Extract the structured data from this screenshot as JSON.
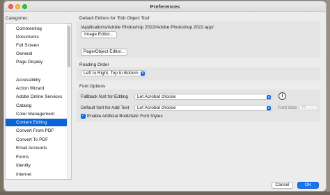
{
  "window": {
    "title": "Preferences"
  },
  "categories": {
    "label": "Categories:",
    "items": [
      "Commenting",
      "Documents",
      "Full Screen",
      "General",
      "Page Display",
      "Accessibility",
      "Action Wizard",
      "Adobe Online Services",
      "Catalog",
      "Color Management",
      "Content Editing",
      "Convert From PDF",
      "Convert To PDF",
      "Email Accounts",
      "Forms",
      "Identity",
      "Internet"
    ],
    "selected": "Content Editing"
  },
  "default_editors": {
    "title": "Default Editors for 'Edit Object Tool'",
    "image_path": "/Applications/Adobe Photoshop 2022/Adobe Photoshop 2022.app/",
    "image_editor_button": "Image Editor...",
    "page_object_editor_button": "Page/Object Editor..."
  },
  "reading_order": {
    "title": "Reading Order",
    "value": "Left to Right, Top to Bottom"
  },
  "font_options": {
    "title": "Font Options",
    "fallback_label": "Fallback font for Editing",
    "fallback_value": "Let Acrobat choose",
    "default_label": "Default font for Add Text",
    "default_value": "Let Acrobat choose",
    "font_size_label": "Font Size",
    "font_size_value": "12",
    "artificial_label": "Enable Artificial Bold/Italic Font Styles",
    "artificial_checked": true
  },
  "footer": {
    "cancel_label": "Cancel",
    "ok_label": "OK"
  },
  "colors": {
    "accent": "#0a63d8",
    "ok_button": "#1a74f0"
  },
  "icons": {
    "info": "info-icon",
    "checkbox": "checkmark-icon",
    "select_arrow": "chevron-updown-icon"
  }
}
